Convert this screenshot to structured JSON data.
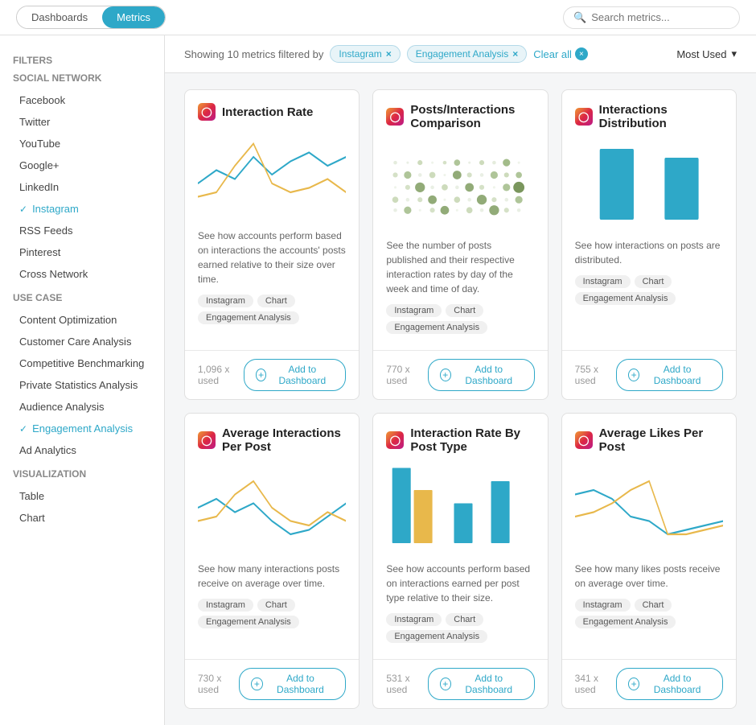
{
  "nav": {
    "tab1": "Dashboards",
    "tab2": "Metrics",
    "search_placeholder": "Search metrics..."
  },
  "filters": {
    "showing_text": "Showing 10 metrics filtered by",
    "tags": [
      "Instagram",
      "Engagement Analysis"
    ],
    "clear_all": "Clear all",
    "sort_label": "Most Used"
  },
  "sidebar": {
    "filters_title": "Filters",
    "sections": [
      {
        "title": "Social Network",
        "items": [
          {
            "label": "Facebook",
            "active": false
          },
          {
            "label": "Twitter",
            "active": false
          },
          {
            "label": "YouTube",
            "active": false
          },
          {
            "label": "Google+",
            "active": false
          },
          {
            "label": "LinkedIn",
            "active": false
          },
          {
            "label": "Instagram",
            "active": true
          },
          {
            "label": "RSS Feeds",
            "active": false
          },
          {
            "label": "Pinterest",
            "active": false
          },
          {
            "label": "Cross Network",
            "active": false
          }
        ]
      },
      {
        "title": "Use Case",
        "items": [
          {
            "label": "Content Optimization",
            "active": false
          },
          {
            "label": "Customer Care Analysis",
            "active": false
          },
          {
            "label": "Competitive Benchmarking",
            "active": false
          },
          {
            "label": "Private Statistics Analysis",
            "active": false
          },
          {
            "label": "Audience Analysis",
            "active": false
          },
          {
            "label": "Engagement Analysis",
            "active": true
          },
          {
            "label": "Ad Analytics",
            "active": false
          }
        ]
      },
      {
        "title": "Visualization",
        "items": [
          {
            "label": "Table",
            "active": false
          },
          {
            "label": "Chart",
            "active": false
          }
        ]
      }
    ]
  },
  "metrics": [
    {
      "id": "interaction-rate",
      "title": "Interaction Rate",
      "description": "See how accounts perform based on interactions the accounts' posts earned relative to their size over time.",
      "tags": [
        "Instagram",
        "Chart",
        "Engagement Analysis"
      ],
      "used": "1,096 x used",
      "add_label": "Add to Dashboard",
      "chart_type": "line"
    },
    {
      "id": "posts-interactions",
      "title": "Posts/Interactions Comparison",
      "description": "See the number of posts published and their respective interaction rates by day of the week and time of day.",
      "tags": [
        "Instagram",
        "Chart",
        "Engagement Analysis"
      ],
      "used": "770 x used",
      "add_label": "Add to Dashboard",
      "chart_type": "dot"
    },
    {
      "id": "interactions-distribution",
      "title": "Interactions Distribution",
      "description": "See how interactions on posts are distributed.",
      "tags": [
        "Instagram",
        "Chart",
        "Engagement Analysis"
      ],
      "used": "755 x used",
      "add_label": "Add to Dashboard",
      "chart_type": "bar2"
    },
    {
      "id": "avg-interactions",
      "title": "Average Interactions Per Post",
      "description": "See how many interactions posts receive on average over time.",
      "tags": [
        "Instagram",
        "Chart",
        "Engagement Analysis"
      ],
      "used": "730 x used",
      "add_label": "Add to Dashboard",
      "chart_type": "line2"
    },
    {
      "id": "interaction-rate-post-type",
      "title": "Interaction Rate By Post Type",
      "description": "See how accounts perform based on interactions earned per post type relative to their size.",
      "tags": [
        "Instagram",
        "Chart",
        "Engagement Analysis"
      ],
      "used": "531 x used",
      "add_label": "Add to Dashboard",
      "chart_type": "bar3"
    },
    {
      "id": "avg-likes",
      "title": "Average Likes Per Post",
      "description": "See how many likes posts receive on average over time.",
      "tags": [
        "Instagram",
        "Chart",
        "Engagement Analysis"
      ],
      "used": "341 x used",
      "add_label": "Add to Dashboard",
      "chart_type": "line3"
    }
  ],
  "icons": {
    "instagram": "◎",
    "search": "🔍",
    "check": "✓",
    "plus": "+",
    "x": "×",
    "chevron_down": "▾"
  }
}
